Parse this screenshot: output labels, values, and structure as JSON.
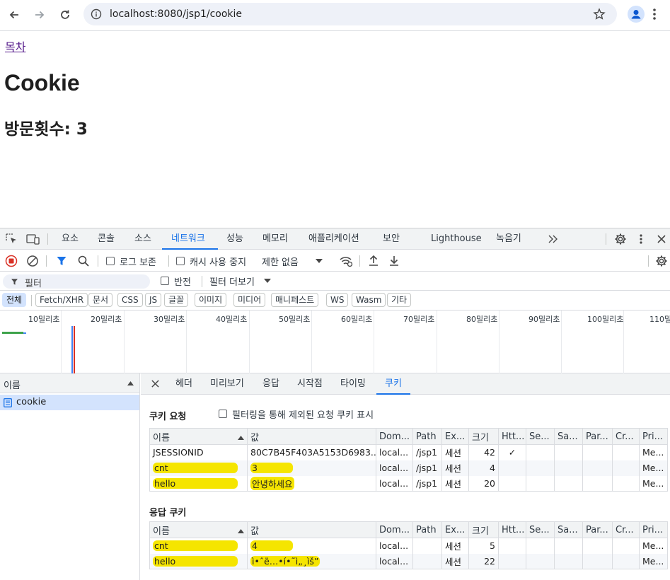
{
  "browser": {
    "url": "localhost:8080/jsp1/cookie"
  },
  "page": {
    "toc_link": "목차",
    "title": "Cookie",
    "visit_label": "방문횟수: 3"
  },
  "devtools": {
    "tabs": [
      "요소",
      "콘솔",
      "소스",
      "네트워크",
      "성능",
      "메모리",
      "애플리케이션",
      "보안",
      "Lighthouse",
      "녹음기"
    ],
    "active_tab": "네트워크",
    "toolbar": {
      "preserve_log": "로그 보존",
      "disable_cache": "캐시 사용 중지",
      "throttle": "제한 없음"
    },
    "filter": {
      "placeholder": "필터",
      "invert": "반전",
      "more_filters": "필터 더보기"
    },
    "type_chips": [
      "전체",
      "Fetch/XHR",
      "문서",
      "CSS",
      "JS",
      "글꼴",
      "이미지",
      "미디어",
      "매니페스트",
      "WS",
      "Wasm",
      "기타"
    ],
    "timeline_ticks": [
      "10밀리초",
      "20밀리초",
      "30밀리초",
      "40밀리초",
      "50밀리초",
      "60밀리초",
      "70밀리초",
      "80밀리초",
      "90밀리초",
      "100밀리초",
      "110밀"
    ],
    "name_header": "이름",
    "request": "cookie",
    "detail_tabs": [
      "헤더",
      "미리보기",
      "응답",
      "시작점",
      "타이밍",
      "쿠키"
    ],
    "active_detail_tab": "쿠키",
    "request_cookies_title": "쿠키 요청",
    "show_filtered_label": "필터링을 통해 제외된 요청 쿠키 표시",
    "response_cookies_title": "응답 쿠키",
    "columns": [
      "이름",
      "값",
      "Dom...",
      "Path",
      "Ex...",
      "크기",
      "Htt...",
      "Se...",
      "Sa...",
      "Par...",
      "Cr...",
      "Pri..."
    ],
    "request_cookies": [
      {
        "name": "JSESSIONID",
        "value": "80C7B45F403A5153D6983...",
        "domain": "local...",
        "path": "/jsp1",
        "expires": "세션",
        "size": "42",
        "httponly": "✓",
        "secure": "",
        "samesite": "",
        "partition": "",
        "cross": "",
        "priority": "Me...",
        "highlight": false
      },
      {
        "name": "cnt",
        "value": "3",
        "domain": "local...",
        "path": "/jsp1",
        "expires": "세션",
        "size": "4",
        "httponly": "",
        "secure": "",
        "samesite": "",
        "partition": "",
        "cross": "",
        "priority": "Me...",
        "highlight": true
      },
      {
        "name": "hello",
        "value": "안녕하세요",
        "domain": "local...",
        "path": "/jsp1",
        "expires": "세션",
        "size": "20",
        "httponly": "",
        "secure": "",
        "samesite": "",
        "partition": "",
        "cross": "",
        "priority": "Me...",
        "highlight": true
      }
    ],
    "response_cookies": [
      {
        "name": "cnt",
        "value": "4",
        "domain": "local...",
        "path": "",
        "expires": "세션",
        "size": "5",
        "httponly": "",
        "secure": "",
        "samesite": "",
        "partition": "",
        "cross": "",
        "priority": "Me...",
        "highlight": true
      },
      {
        "name": "hello",
        "value": "ì•ˆë…•í•˜ì„¸ìš”",
        "domain": "local...",
        "path": "",
        "expires": "세션",
        "size": "22",
        "httponly": "",
        "secure": "",
        "samesite": "",
        "partition": "",
        "cross": "",
        "priority": "Me...",
        "highlight": true
      }
    ]
  },
  "colors": {
    "accent": "#1a73e8",
    "highlight": "#f5e500",
    "record": "#d93025"
  }
}
